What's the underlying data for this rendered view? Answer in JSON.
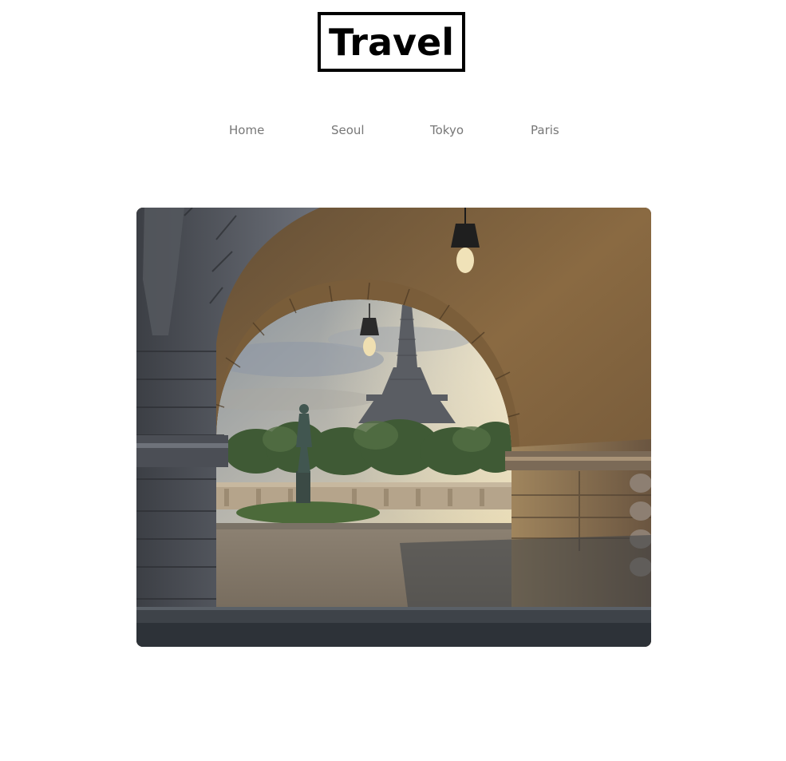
{
  "header": {
    "logo_text": "Travel"
  },
  "nav": {
    "items": [
      {
        "label": "Home"
      },
      {
        "label": "Seoul"
      },
      {
        "label": "Tokyo"
      },
      {
        "label": "Paris"
      }
    ]
  },
  "hero": {
    "image_subject": "paris-eiffel-tower-through-stone-arch"
  }
}
